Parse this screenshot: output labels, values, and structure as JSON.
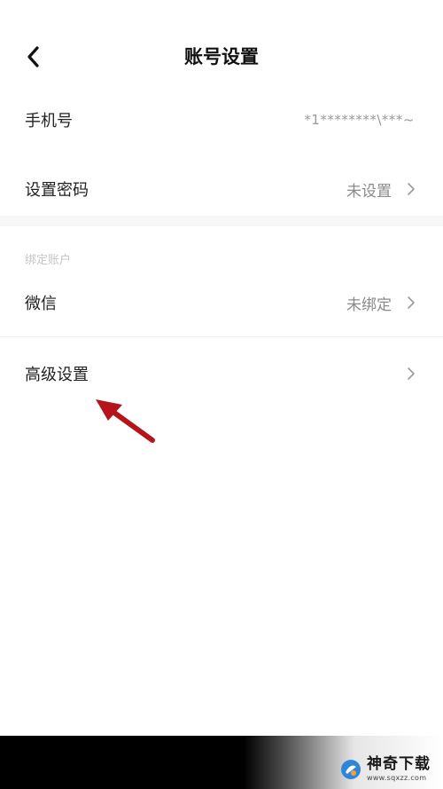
{
  "header": {
    "title": "账号设置",
    "back_icon": "chevron-left-icon"
  },
  "account": {
    "phone": {
      "label": "手机号",
      "value": "*1********\\***~"
    },
    "password": {
      "label": "设置密码",
      "value": "未设置"
    }
  },
  "bind_section": {
    "title": "绑定账户",
    "wechat": {
      "label": "微信",
      "value": "未绑定"
    }
  },
  "advanced": {
    "label": "高级设置"
  },
  "annotation": {
    "arrow_color": "#b5141a",
    "icon": "red-arrow-icon"
  },
  "watermark": {
    "title": "神奇下载",
    "url": "www.sqxzz.com"
  },
  "colors": {
    "background": "#ffffff",
    "text_primary": "#222222",
    "text_secondary": "#8a8a8a",
    "section_gap": "#f7f7f7"
  }
}
